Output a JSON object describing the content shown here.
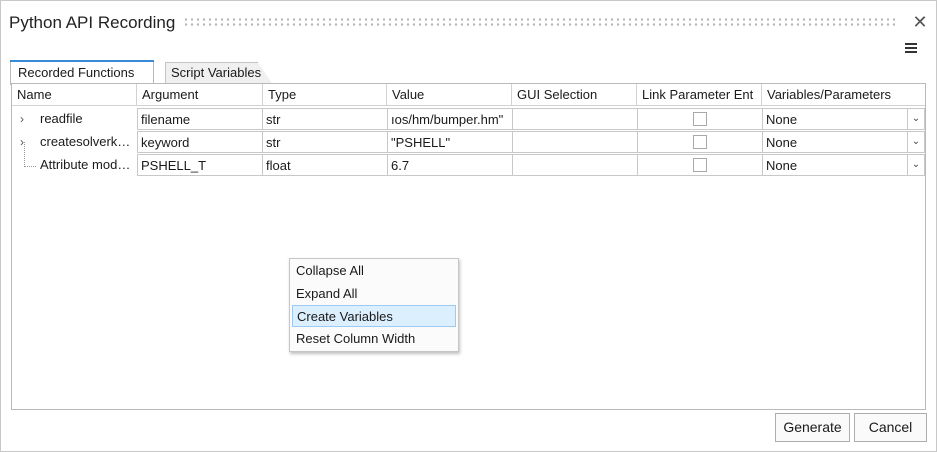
{
  "window": {
    "title": "Python API Recording",
    "close_icon": "close-icon",
    "menu_icon": "hamburger-menu-icon"
  },
  "tabs": [
    {
      "label": "Recorded Functions",
      "active": true
    },
    {
      "label": "Script Variables",
      "active": false
    }
  ],
  "table": {
    "columns": [
      "Name",
      "Argument",
      "Type",
      "Value",
      "GUI Selection",
      "Link Parameter Ent",
      "Variables/Parameters"
    ],
    "rows": [
      {
        "name": "readfile",
        "argument": "filename",
        "type": "str",
        "value": "ıos/hm/bumper.hm\"",
        "gui_selection": "",
        "link_checked": false,
        "variable": "None",
        "expandable": true
      },
      {
        "name": "createsolverk…",
        "argument": "keyword",
        "type": "str",
        "value": "\"PSHELL\"",
        "gui_selection": "",
        "link_checked": false,
        "variable": "None",
        "expandable": true
      },
      {
        "name": "Attribute mod…",
        "argument": "PSHELL_T",
        "type": "float",
        "value": "6.7",
        "gui_selection": "",
        "link_checked": false,
        "variable": "None",
        "expandable": false
      }
    ]
  },
  "context_menu": {
    "items": [
      "Collapse All",
      "Expand All",
      "Create Variables",
      "Reset Column Width"
    ],
    "highlighted": "Create Variables"
  },
  "buttons": {
    "generate": "Generate",
    "cancel": "Cancel"
  },
  "colors": {
    "tab_accent": "#3a8ad6",
    "menu_highlight": "#dcefff"
  }
}
